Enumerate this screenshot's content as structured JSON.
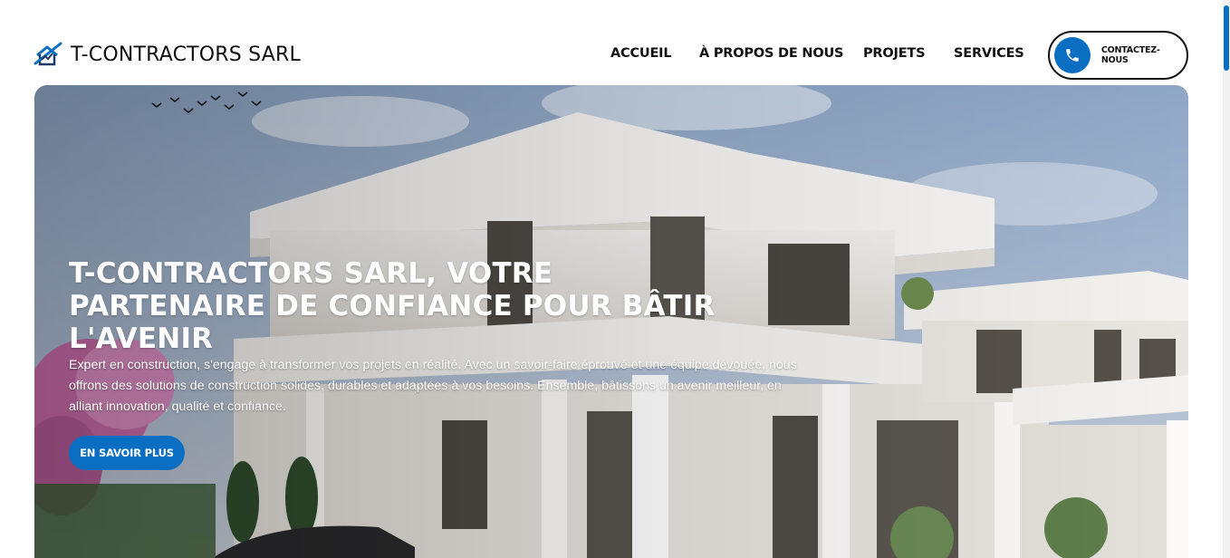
{
  "header": {
    "brand": "T-CONTRACTORS SARL",
    "logo_icon": "house-swoosh-logo",
    "nav": [
      {
        "label": "ACCUEIL"
      },
      {
        "label": "À PROPOS DE NOUS"
      },
      {
        "label": "PROJETS"
      },
      {
        "label": "SERVICES"
      }
    ],
    "contact_label": "CONTACTEZ-NOUS",
    "contact_icon": "phone-icon"
  },
  "hero": {
    "title": "T-CONTRACTORS SARL, VOTRE PARTENAIRE DE CONFIANCE POUR BÂTIR L'AVENIR",
    "description": "Expert en construction, s'engage à transformer vos projets en réalité. Avec un savoir-faire éprouvé et une équipe dévouée, nous offrons des solutions de construction solides, durables et adaptées à vos besoins. Ensemble, bâtissons un avenir meilleur, en alliant innovation, qualité et confiance.",
    "button_label": "EN SAVOIR PLUS",
    "background_image": "modern-white-villa-photo"
  },
  "colors": {
    "accent": "#0a6fc2",
    "text": "#111111",
    "background": "#ffffff"
  }
}
